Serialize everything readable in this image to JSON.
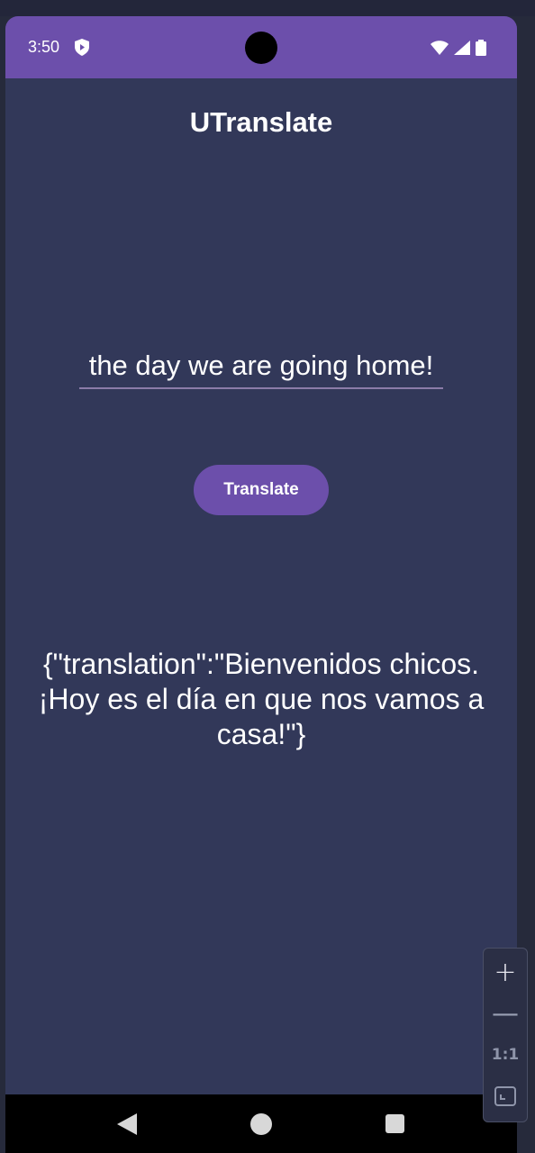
{
  "status_bar": {
    "time": "3:50",
    "icons": [
      "shield-icon",
      "wifi-icon",
      "signal-icon",
      "battery-icon"
    ],
    "color": "#6c4fab"
  },
  "app": {
    "title": "UTranslate",
    "input": {
      "value": "the day we are going home!",
      "placeholder": ""
    },
    "translate_button_label": "Translate",
    "result": "{\"translation\":\"Bienvenidos chicos. ¡Hoy es el día en que nos vamos a casa!\"}"
  },
  "nav_bar": {
    "buttons": [
      "back-icon",
      "home-icon",
      "recents-icon"
    ]
  },
  "zoom_controls": {
    "zoom_in_label": "+",
    "zoom_out_label": "—",
    "reset_label": "1:1",
    "fit_icon": "fit-screen-icon"
  },
  "colors": {
    "accent": "#6c4fab",
    "background": "#323859",
    "text": "#ffffff"
  }
}
